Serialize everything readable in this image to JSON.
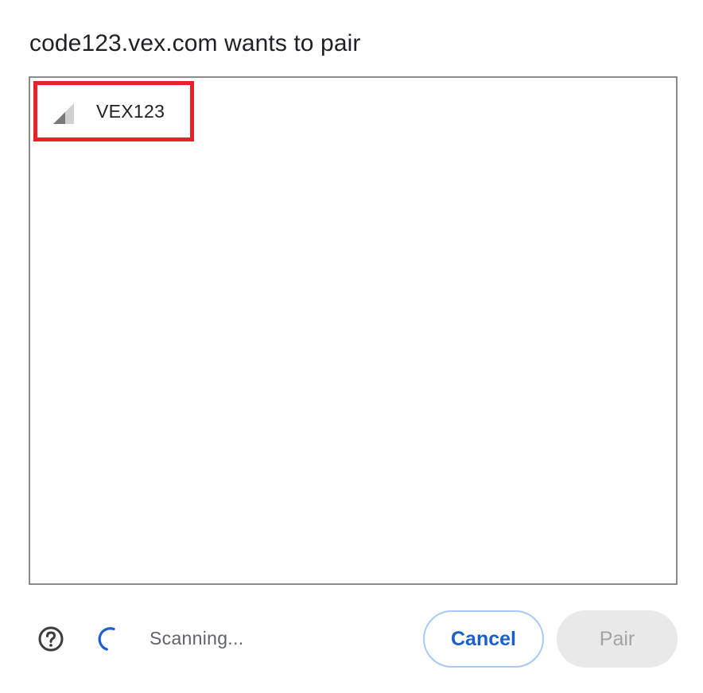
{
  "dialog": {
    "title": "code123.vex.com wants to pair"
  },
  "device_list": {
    "items": [
      {
        "name": "VEX123",
        "icon": "signal-strength-icon",
        "selected_highlight_color": "#e8202a"
      }
    ]
  },
  "footer": {
    "help_icon": "help-circle-icon",
    "spinner_icon": "loading-spinner-icon",
    "status": "Scanning...",
    "cancel_label": "Cancel",
    "pair_label": "Pair"
  },
  "colors": {
    "accent": "#1a5fd0",
    "cancel_border": "#a8c7fa",
    "pair_disabled_bg": "#e9e9e9",
    "pair_disabled_text": "#a3a3a3",
    "highlight": "#e8202a"
  }
}
